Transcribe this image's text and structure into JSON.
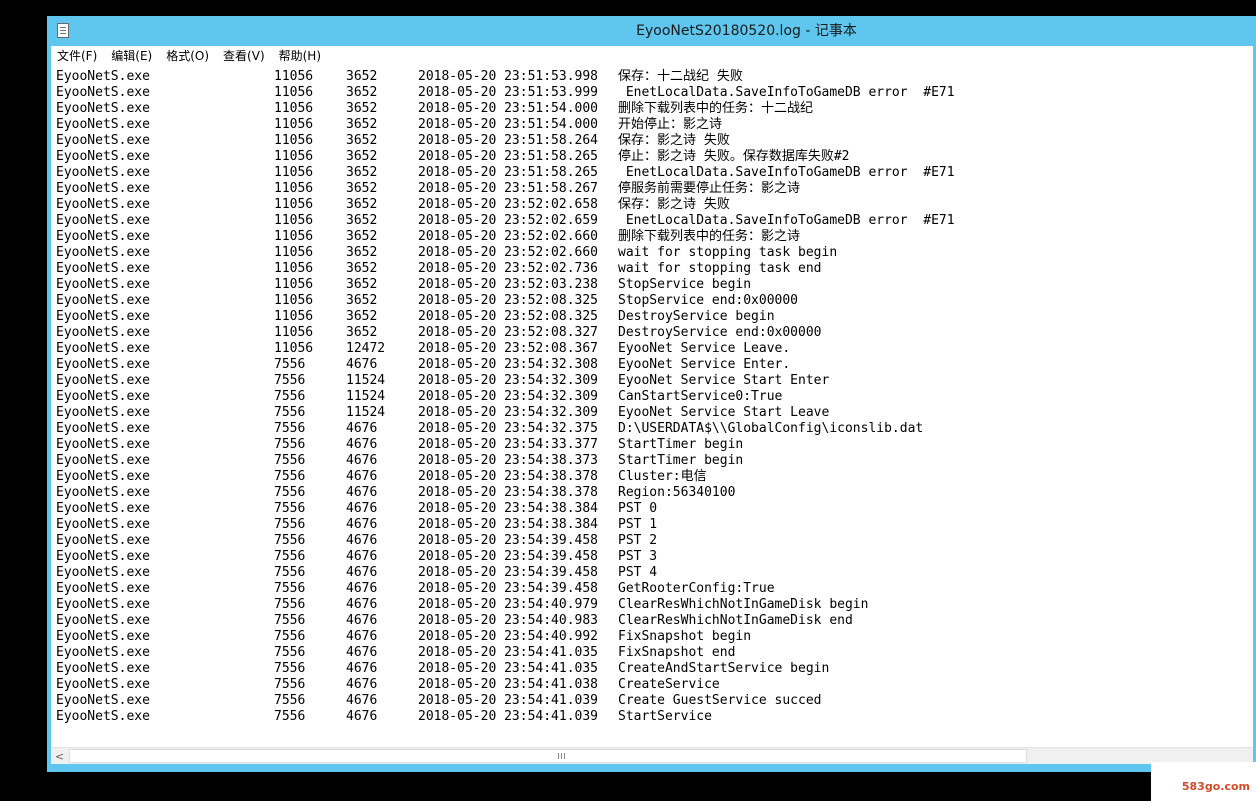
{
  "window": {
    "title": "EyooNetS20180520.log - 记事本"
  },
  "menu": [
    {
      "label": "文件(F)"
    },
    {
      "label": "编辑(E)"
    },
    {
      "label": "格式(O)"
    },
    {
      "label": "查看(V)"
    },
    {
      "label": "帮助(H)"
    }
  ],
  "log": [
    {
      "name": "EyooNetS.exe",
      "pid": "11056",
      "tid": "3652",
      "time": "2018-05-20 23:51:53.998",
      "msg": "保存：十二战纪 失败"
    },
    {
      "name": "EyooNetS.exe",
      "pid": "11056",
      "tid": "3652",
      "time": "2018-05-20 23:51:53.999",
      "msg": " EnetLocalData.SaveInfoToGameDB error  #E71"
    },
    {
      "name": "EyooNetS.exe",
      "pid": "11056",
      "tid": "3652",
      "time": "2018-05-20 23:51:54.000",
      "msg": "删除下载列表中的任务：十二战纪"
    },
    {
      "name": "EyooNetS.exe",
      "pid": "11056",
      "tid": "3652",
      "time": "2018-05-20 23:51:54.000",
      "msg": "开始停止：影之诗"
    },
    {
      "name": "EyooNetS.exe",
      "pid": "11056",
      "tid": "3652",
      "time": "2018-05-20 23:51:58.264",
      "msg": "保存：影之诗 失败"
    },
    {
      "name": "EyooNetS.exe",
      "pid": "11056",
      "tid": "3652",
      "time": "2018-05-20 23:51:58.265",
      "msg": "停止：影之诗 失败。保存数据库失败#2"
    },
    {
      "name": "EyooNetS.exe",
      "pid": "11056",
      "tid": "3652",
      "time": "2018-05-20 23:51:58.265",
      "msg": " EnetLocalData.SaveInfoToGameDB error  #E71"
    },
    {
      "name": "EyooNetS.exe",
      "pid": "11056",
      "tid": "3652",
      "time": "2018-05-20 23:51:58.267",
      "msg": "停服务前需要停止任务：影之诗"
    },
    {
      "name": "EyooNetS.exe",
      "pid": "11056",
      "tid": "3652",
      "time": "2018-05-20 23:52:02.658",
      "msg": "保存：影之诗 失败"
    },
    {
      "name": "EyooNetS.exe",
      "pid": "11056",
      "tid": "3652",
      "time": "2018-05-20 23:52:02.659",
      "msg": " EnetLocalData.SaveInfoToGameDB error  #E71"
    },
    {
      "name": "EyooNetS.exe",
      "pid": "11056",
      "tid": "3652",
      "time": "2018-05-20 23:52:02.660",
      "msg": "删除下载列表中的任务：影之诗"
    },
    {
      "name": "EyooNetS.exe",
      "pid": "11056",
      "tid": "3652",
      "time": "2018-05-20 23:52:02.660",
      "msg": "wait for stopping task begin"
    },
    {
      "name": "EyooNetS.exe",
      "pid": "11056",
      "tid": "3652",
      "time": "2018-05-20 23:52:02.736",
      "msg": "wait for stopping task end"
    },
    {
      "name": "EyooNetS.exe",
      "pid": "11056",
      "tid": "3652",
      "time": "2018-05-20 23:52:03.238",
      "msg": "StopService begin"
    },
    {
      "name": "EyooNetS.exe",
      "pid": "11056",
      "tid": "3652",
      "time": "2018-05-20 23:52:08.325",
      "msg": "StopService end:0x00000"
    },
    {
      "name": "EyooNetS.exe",
      "pid": "11056",
      "tid": "3652",
      "time": "2018-05-20 23:52:08.325",
      "msg": "DestroyService begin"
    },
    {
      "name": "EyooNetS.exe",
      "pid": "11056",
      "tid": "3652",
      "time": "2018-05-20 23:52:08.327",
      "msg": "DestroyService end:0x00000"
    },
    {
      "name": "EyooNetS.exe",
      "pid": "11056",
      "tid": "12472",
      "time": "2018-05-20 23:52:08.367",
      "msg": "EyooNet Service Leave."
    },
    {
      "name": "EyooNetS.exe",
      "pid": "7556",
      "tid": "4676",
      "time": "2018-05-20 23:54:32.308",
      "msg": "EyooNet Service Enter."
    },
    {
      "name": "EyooNetS.exe",
      "pid": "7556",
      "tid": "11524",
      "time": "2018-05-20 23:54:32.309",
      "msg": "EyooNet Service Start Enter"
    },
    {
      "name": "EyooNetS.exe",
      "pid": "7556",
      "tid": "11524",
      "time": "2018-05-20 23:54:32.309",
      "msg": "CanStartService0:True"
    },
    {
      "name": "EyooNetS.exe",
      "pid": "7556",
      "tid": "11524",
      "time": "2018-05-20 23:54:32.309",
      "msg": "EyooNet Service Start Leave"
    },
    {
      "name": "EyooNetS.exe",
      "pid": "7556",
      "tid": "4676",
      "time": "2018-05-20 23:54:32.375",
      "msg": "D:\\USERDATA$\\\\GlobalConfig\\iconslib.dat"
    },
    {
      "name": "EyooNetS.exe",
      "pid": "7556",
      "tid": "4676",
      "time": "2018-05-20 23:54:33.377",
      "msg": "StartTimer begin"
    },
    {
      "name": "EyooNetS.exe",
      "pid": "7556",
      "tid": "4676",
      "time": "2018-05-20 23:54:38.373",
      "msg": "StartTimer begin"
    },
    {
      "name": "EyooNetS.exe",
      "pid": "7556",
      "tid": "4676",
      "time": "2018-05-20 23:54:38.378",
      "msg": "Cluster:电信"
    },
    {
      "name": "EyooNetS.exe",
      "pid": "7556",
      "tid": "4676",
      "time": "2018-05-20 23:54:38.378",
      "msg": "Region:56340100"
    },
    {
      "name": "EyooNetS.exe",
      "pid": "7556",
      "tid": "4676",
      "time": "2018-05-20 23:54:38.384",
      "msg": "PST 0"
    },
    {
      "name": "EyooNetS.exe",
      "pid": "7556",
      "tid": "4676",
      "time": "2018-05-20 23:54:38.384",
      "msg": "PST 1"
    },
    {
      "name": "EyooNetS.exe",
      "pid": "7556",
      "tid": "4676",
      "time": "2018-05-20 23:54:39.458",
      "msg": "PST 2"
    },
    {
      "name": "EyooNetS.exe",
      "pid": "7556",
      "tid": "4676",
      "time": "2018-05-20 23:54:39.458",
      "msg": "PST 3"
    },
    {
      "name": "EyooNetS.exe",
      "pid": "7556",
      "tid": "4676",
      "time": "2018-05-20 23:54:39.458",
      "msg": "PST 4"
    },
    {
      "name": "EyooNetS.exe",
      "pid": "7556",
      "tid": "4676",
      "time": "2018-05-20 23:54:39.458",
      "msg": "GetRooterConfig:True"
    },
    {
      "name": "EyooNetS.exe",
      "pid": "7556",
      "tid": "4676",
      "time": "2018-05-20 23:54:40.979",
      "msg": "ClearResWhichNotInGameDisk begin"
    },
    {
      "name": "EyooNetS.exe",
      "pid": "7556",
      "tid": "4676",
      "time": "2018-05-20 23:54:40.983",
      "msg": "ClearResWhichNotInGameDisk end"
    },
    {
      "name": "EyooNetS.exe",
      "pid": "7556",
      "tid": "4676",
      "time": "2018-05-20 23:54:40.992",
      "msg": "FixSnapshot begin"
    },
    {
      "name": "EyooNetS.exe",
      "pid": "7556",
      "tid": "4676",
      "time": "2018-05-20 23:54:41.035",
      "msg": "FixSnapshot end"
    },
    {
      "name": "EyooNetS.exe",
      "pid": "7556",
      "tid": "4676",
      "time": "2018-05-20 23:54:41.035",
      "msg": "CreateAndStartService begin"
    },
    {
      "name": "EyooNetS.exe",
      "pid": "7556",
      "tid": "4676",
      "time": "2018-05-20 23:54:41.038",
      "msg": "CreateService"
    },
    {
      "name": "EyooNetS.exe",
      "pid": "7556",
      "tid": "4676",
      "time": "2018-05-20 23:54:41.039",
      "msg": "Create GuestService succed"
    },
    {
      "name": "EyooNetS.exe",
      "pid": "7556",
      "tid": "4676",
      "time": "2018-05-20 23:54:41.039",
      "msg": "StartService"
    }
  ],
  "scrollbar": {
    "left_arrow": "<"
  },
  "watermark": {
    "text": "583go.com"
  },
  "colors": {
    "titlebar": "#5fc7ef",
    "editor_bg": "#ffffff",
    "text": "#000000"
  },
  "icons": {
    "app": "notepad-icon"
  }
}
